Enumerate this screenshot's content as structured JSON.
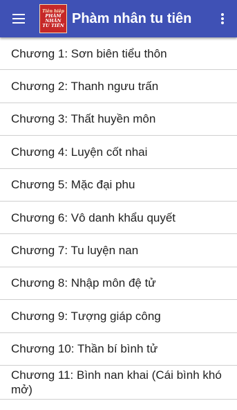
{
  "app_bar": {
    "title": "Phàm nhân tu tiên",
    "menu_icon": "hamburger-menu-icon",
    "overflow_icon": "more-vert-icon",
    "logo": {
      "line1": "Tiên hiệp",
      "line2": "PHÀM",
      "line3": "NHÂN",
      "line4": "TU TIÊN"
    },
    "colors": {
      "background": "#3f51b5",
      "logo_red": "#c62828"
    }
  },
  "chapters": [
    "Chương 1: Sơn biên tiểu thôn",
    "Chương 2: Thanh ngưu trấn",
    "Chương 3: Thất huyền môn",
    "Chương 4: Luyện cốt nhai",
    "Chương 5: Mặc đại phu",
    "Chương 6: Vô danh khẩu quyết",
    "Chương 7: Tu luyện nan",
    "Chương 8: Nhập môn đệ tử",
    "Chương 9: Tượng giáp công",
    "Chương 10: Thần bí bình tử",
    "Chương 11: Bình nan khai (Cái bình khó mở)"
  ]
}
